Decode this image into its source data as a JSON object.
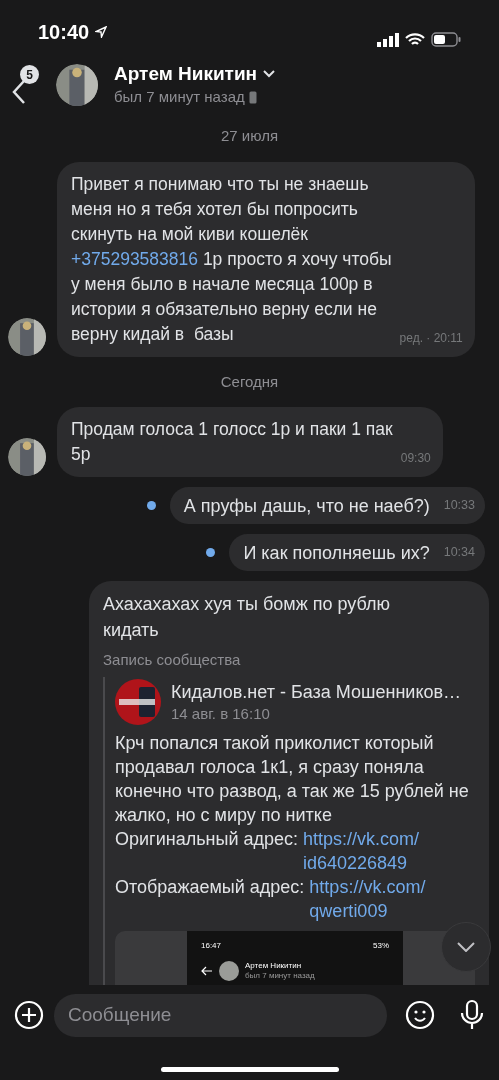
{
  "status_bar": {
    "time": "10:40"
  },
  "header": {
    "unread_count": "5",
    "name": "Артем Никитин",
    "presence": "был 7 минут назад"
  },
  "messages": [
    {
      "kind": "date",
      "text": "27 июля"
    },
    {
      "kind": "incoming",
      "avatar": true,
      "parts": [
        {
          "kind": "text",
          "text": "Привет я понимаю что ты не знаешь\nменя но я тебя хотел бы попросить\nскинуть на мой киви кошелёк\n"
        },
        {
          "kind": "link",
          "text": "+375293583816"
        },
        {
          "kind": "text",
          "text": " 1р просто я хочу чтобы\nу меня было в начале месяца 100р в\nистории я обязательно верну если не\nверну кидай в  базы"
        }
      ],
      "meta": "ред. · 20:11"
    },
    {
      "kind": "date",
      "text": "Сегодня"
    },
    {
      "kind": "incoming",
      "avatar": true,
      "parts": [
        {
          "kind": "text",
          "text": "Продам голоса 1 голосс 1р и паки 1 пак\n5р"
        }
      ],
      "meta": "09:30"
    },
    {
      "kind": "outgoing",
      "unread": true,
      "parts": [
        {
          "kind": "text",
          "text": "А пруфы дашь, что не наеб?)"
        }
      ],
      "meta": "10:33"
    },
    {
      "kind": "outgoing",
      "unread": true,
      "parts": [
        {
          "kind": "text",
          "text": "И как пополняешь их?"
        }
      ],
      "meta": "10:34"
    },
    {
      "kind": "repost",
      "text": "Ахахахахах хуя ты бомж по рублю\nкидать",
      "caption": "Запись сообщества",
      "group": "Кидалов.нет - База Мошенников…",
      "date": "14 авг. в 16:10",
      "body": [
        {
          "kind": "text",
          "text": "Крч попался такой приколист который\nпродавал голоса 1к1, я сразу поняла\nконечно что развод, а так же 15 рублей не\nжалко, но с миру по нитке\nОригинальный адрес: "
        },
        {
          "kind": "link",
          "text": "https://vk.com/\nid640226849"
        },
        {
          "kind": "text",
          "text": "\nОтображаемый адрес: "
        },
        {
          "kind": "link",
          "text": "https://vk.com/\nqwerti009"
        }
      ],
      "screenshot": {
        "time": "16:47",
        "battery": "53%",
        "name": "Артем Никитин",
        "presence": "был 7 минут назад"
      }
    }
  ],
  "composer": {
    "placeholder": "Сообщение"
  }
}
